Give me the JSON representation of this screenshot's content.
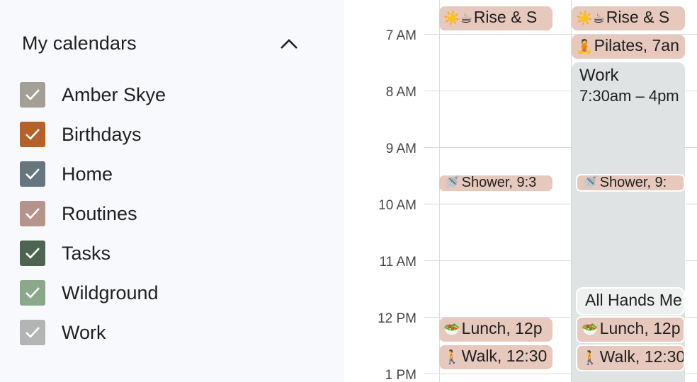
{
  "sidebar": {
    "section_title": "My calendars",
    "calendars": [
      {
        "label": "Amber Skye",
        "color": "#a39f95",
        "checked": true
      },
      {
        "label": "Birthdays",
        "color": "#b4622a",
        "checked": true
      },
      {
        "label": "Home",
        "color": "#65767f",
        "checked": true
      },
      {
        "label": "Routines",
        "color": "#b5958b",
        "checked": true
      },
      {
        "label": "Tasks",
        "color": "#4d6450",
        "checked": true
      },
      {
        "label": "Wildground",
        "color": "#8aa88a",
        "checked": true
      },
      {
        "label": "Work",
        "color": "#b3b5b4",
        "checked": true
      }
    ]
  },
  "grid": {
    "time_labels": [
      "7 AM",
      "8 AM",
      "9 AM",
      "10 AM",
      "11 AM",
      "12 PM",
      "1 PM"
    ],
    "day1": {
      "rise": {
        "emoji": "☀️☕",
        "title": "Rise & S"
      },
      "shower": {
        "emoji": "🚿",
        "title": "Shower, 9:3"
      },
      "lunch": {
        "emoji": "🥗",
        "title": "Lunch, 12p"
      },
      "walk": {
        "emoji": "🚶",
        "title": "Walk, 12:30"
      }
    },
    "day2": {
      "rise": {
        "emoji": "☀️☕",
        "title": "Rise & S"
      },
      "pilates": {
        "emoji": "🧘",
        "title": "Pilates, 7an"
      },
      "work": {
        "title": "Work",
        "time": "7:30am – 4pm"
      },
      "shower": {
        "emoji": "🚿",
        "title": "Shower, 9:"
      },
      "meeting": {
        "title": "All Hands Me"
      },
      "lunch": {
        "emoji": "🥗",
        "title": "Lunch, 12p"
      },
      "walk": {
        "emoji": "🚶",
        "title": "Walk, 12:30"
      }
    }
  }
}
